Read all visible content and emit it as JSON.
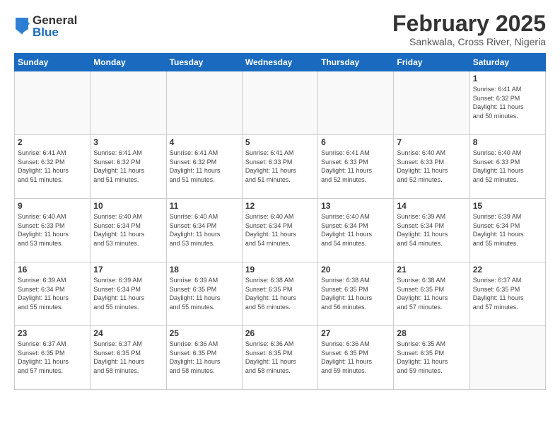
{
  "header": {
    "logo_general": "General",
    "logo_blue": "Blue",
    "month_title": "February 2025",
    "location": "Sankwala, Cross River, Nigeria"
  },
  "days_of_week": [
    "Sunday",
    "Monday",
    "Tuesday",
    "Wednesday",
    "Thursday",
    "Friday",
    "Saturday"
  ],
  "weeks": [
    [
      {
        "day": "",
        "info": ""
      },
      {
        "day": "",
        "info": ""
      },
      {
        "day": "",
        "info": ""
      },
      {
        "day": "",
        "info": ""
      },
      {
        "day": "",
        "info": ""
      },
      {
        "day": "",
        "info": ""
      },
      {
        "day": "1",
        "info": "Sunrise: 6:41 AM\nSunset: 6:32 PM\nDaylight: 11 hours\nand 50 minutes."
      }
    ],
    [
      {
        "day": "2",
        "info": "Sunrise: 6:41 AM\nSunset: 6:32 PM\nDaylight: 11 hours\nand 51 minutes."
      },
      {
        "day": "3",
        "info": "Sunrise: 6:41 AM\nSunset: 6:32 PM\nDaylight: 11 hours\nand 51 minutes."
      },
      {
        "day": "4",
        "info": "Sunrise: 6:41 AM\nSunset: 6:32 PM\nDaylight: 11 hours\nand 51 minutes."
      },
      {
        "day": "5",
        "info": "Sunrise: 6:41 AM\nSunset: 6:33 PM\nDaylight: 11 hours\nand 51 minutes."
      },
      {
        "day": "6",
        "info": "Sunrise: 6:41 AM\nSunset: 6:33 PM\nDaylight: 11 hours\nand 52 minutes."
      },
      {
        "day": "7",
        "info": "Sunrise: 6:40 AM\nSunset: 6:33 PM\nDaylight: 11 hours\nand 52 minutes."
      },
      {
        "day": "8",
        "info": "Sunrise: 6:40 AM\nSunset: 6:33 PM\nDaylight: 11 hours\nand 52 minutes."
      }
    ],
    [
      {
        "day": "9",
        "info": "Sunrise: 6:40 AM\nSunset: 6:33 PM\nDaylight: 11 hours\nand 53 minutes."
      },
      {
        "day": "10",
        "info": "Sunrise: 6:40 AM\nSunset: 6:34 PM\nDaylight: 11 hours\nand 53 minutes."
      },
      {
        "day": "11",
        "info": "Sunrise: 6:40 AM\nSunset: 6:34 PM\nDaylight: 11 hours\nand 53 minutes."
      },
      {
        "day": "12",
        "info": "Sunrise: 6:40 AM\nSunset: 6:34 PM\nDaylight: 11 hours\nand 54 minutes."
      },
      {
        "day": "13",
        "info": "Sunrise: 6:40 AM\nSunset: 6:34 PM\nDaylight: 11 hours\nand 54 minutes."
      },
      {
        "day": "14",
        "info": "Sunrise: 6:39 AM\nSunset: 6:34 PM\nDaylight: 11 hours\nand 54 minutes."
      },
      {
        "day": "15",
        "info": "Sunrise: 6:39 AM\nSunset: 6:34 PM\nDaylight: 11 hours\nand 55 minutes."
      }
    ],
    [
      {
        "day": "16",
        "info": "Sunrise: 6:39 AM\nSunset: 6:34 PM\nDaylight: 11 hours\nand 55 minutes."
      },
      {
        "day": "17",
        "info": "Sunrise: 6:39 AM\nSunset: 6:34 PM\nDaylight: 11 hours\nand 55 minutes."
      },
      {
        "day": "18",
        "info": "Sunrise: 6:39 AM\nSunset: 6:35 PM\nDaylight: 11 hours\nand 55 minutes."
      },
      {
        "day": "19",
        "info": "Sunrise: 6:38 AM\nSunset: 6:35 PM\nDaylight: 11 hours\nand 56 minutes."
      },
      {
        "day": "20",
        "info": "Sunrise: 6:38 AM\nSunset: 6:35 PM\nDaylight: 11 hours\nand 56 minutes."
      },
      {
        "day": "21",
        "info": "Sunrise: 6:38 AM\nSunset: 6:35 PM\nDaylight: 11 hours\nand 57 minutes."
      },
      {
        "day": "22",
        "info": "Sunrise: 6:37 AM\nSunset: 6:35 PM\nDaylight: 11 hours\nand 57 minutes."
      }
    ],
    [
      {
        "day": "23",
        "info": "Sunrise: 6:37 AM\nSunset: 6:35 PM\nDaylight: 11 hours\nand 57 minutes."
      },
      {
        "day": "24",
        "info": "Sunrise: 6:37 AM\nSunset: 6:35 PM\nDaylight: 11 hours\nand 58 minutes."
      },
      {
        "day": "25",
        "info": "Sunrise: 6:36 AM\nSunset: 6:35 PM\nDaylight: 11 hours\nand 58 minutes."
      },
      {
        "day": "26",
        "info": "Sunrise: 6:36 AM\nSunset: 6:35 PM\nDaylight: 11 hours\nand 58 minutes."
      },
      {
        "day": "27",
        "info": "Sunrise: 6:36 AM\nSunset: 6:35 PM\nDaylight: 11 hours\nand 59 minutes."
      },
      {
        "day": "28",
        "info": "Sunrise: 6:35 AM\nSunset: 6:35 PM\nDaylight: 11 hours\nand 59 minutes."
      },
      {
        "day": "",
        "info": ""
      }
    ]
  ]
}
